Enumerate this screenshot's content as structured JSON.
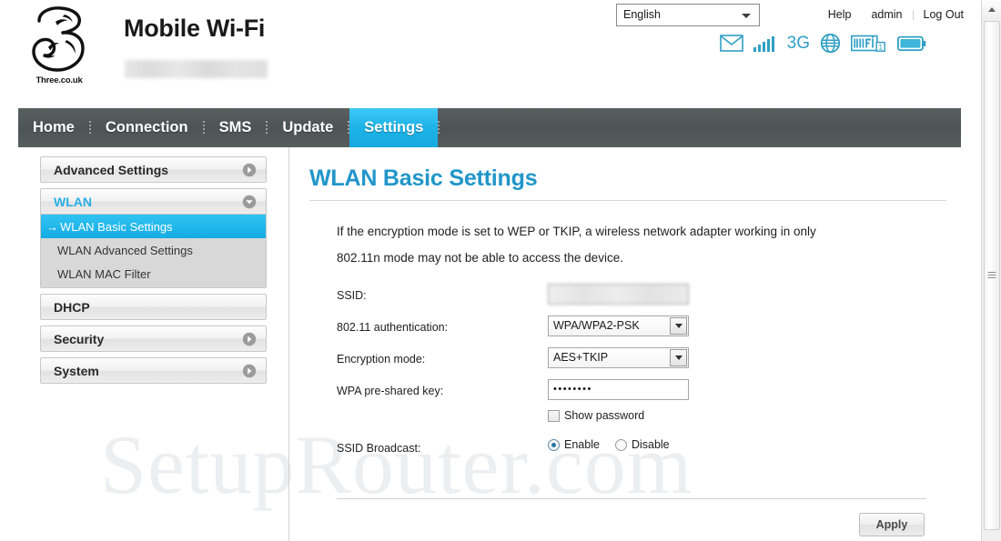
{
  "header": {
    "brand_title": "Mobile Wi-Fi",
    "logo_caption": "Three.co.uk",
    "logo_mark_name": "three-logo",
    "device_name_redacted": "",
    "language": {
      "selected": "English",
      "options": [
        "English"
      ]
    },
    "links": [
      {
        "label": "Help",
        "name": "help-link"
      },
      {
        "label": "admin",
        "name": "admin-link"
      },
      {
        "label": "Log Out",
        "name": "logout-link"
      }
    ],
    "status_icons": [
      {
        "name": "mail-icon",
        "label": "Messages"
      },
      {
        "name": "signal-bars-icon",
        "label": "Signal strength"
      },
      {
        "name": "network-type-icon",
        "label": "3G"
      },
      {
        "name": "globe-icon",
        "label": "Internet"
      },
      {
        "name": "wifi-icon",
        "label": "WiFi 1 client"
      },
      {
        "name": "battery-icon",
        "label": "Battery"
      }
    ],
    "network_type_text": "3G",
    "wifi_client_count": "1"
  },
  "nav": {
    "items": [
      {
        "label": "Home",
        "active": false
      },
      {
        "label": "Connection",
        "active": false
      },
      {
        "label": "SMS",
        "active": false
      },
      {
        "label": "Update",
        "active": false
      },
      {
        "label": "Settings",
        "active": true
      }
    ]
  },
  "sidebar": {
    "groups": [
      {
        "label": "Advanced Settings",
        "state": "collapsed",
        "chevron": "chevron-right-icon",
        "children": []
      },
      {
        "label": "WLAN",
        "state": "expanded",
        "chevron": "chevron-down-icon",
        "children": [
          {
            "label": "WLAN Basic Settings",
            "selected": true,
            "arrow": "→"
          },
          {
            "label": "WLAN Advanced Settings",
            "selected": false
          },
          {
            "label": "WLAN MAC Filter",
            "selected": false
          }
        ]
      },
      {
        "label": "DHCP",
        "state": "collapsed",
        "chevron": "",
        "children": []
      },
      {
        "label": "Security",
        "state": "collapsed",
        "chevron": "chevron-right-icon",
        "children": []
      },
      {
        "label": "System",
        "state": "collapsed",
        "chevron": "chevron-right-icon",
        "children": []
      }
    ]
  },
  "main": {
    "title": "WLAN Basic Settings",
    "notice_line1": "If the encryption mode is set to WEP or TKIP, a wireless network adapter working in only",
    "notice_line2": "802.11n mode may not be able to access the device.",
    "fields": {
      "ssid_label": "SSID:",
      "ssid_value": "",
      "auth_label": "802.11 authentication:",
      "auth_value": "WPA/WPA2-PSK",
      "auth_options": [
        "WPA/WPA2-PSK"
      ],
      "encryption_label": "Encryption mode:",
      "encryption_value": "AES+TKIP",
      "encryption_options": [
        "AES+TKIP"
      ],
      "psk_label": "WPA pre-shared key:",
      "psk_value": "••••••••",
      "show_password_label": "Show password",
      "show_password_checked": false,
      "broadcast_label": "SSID Broadcast:",
      "broadcast_enable_label": "Enable",
      "broadcast_disable_label": "Disable",
      "broadcast_value": "Enable"
    },
    "apply_label": "Apply"
  },
  "watermark": {
    "text": "SetupRouter.com"
  },
  "scrollbar": {
    "up_arrow_name": "scroll-up-arrow",
    "thumb_name": "scroll-thumb"
  },
  "colors": {
    "accent_cyan": "#1cb3e8",
    "title_blue": "#2196c9",
    "nav_gray": "#4e5456",
    "icon_teal": "#2f9fc4"
  }
}
